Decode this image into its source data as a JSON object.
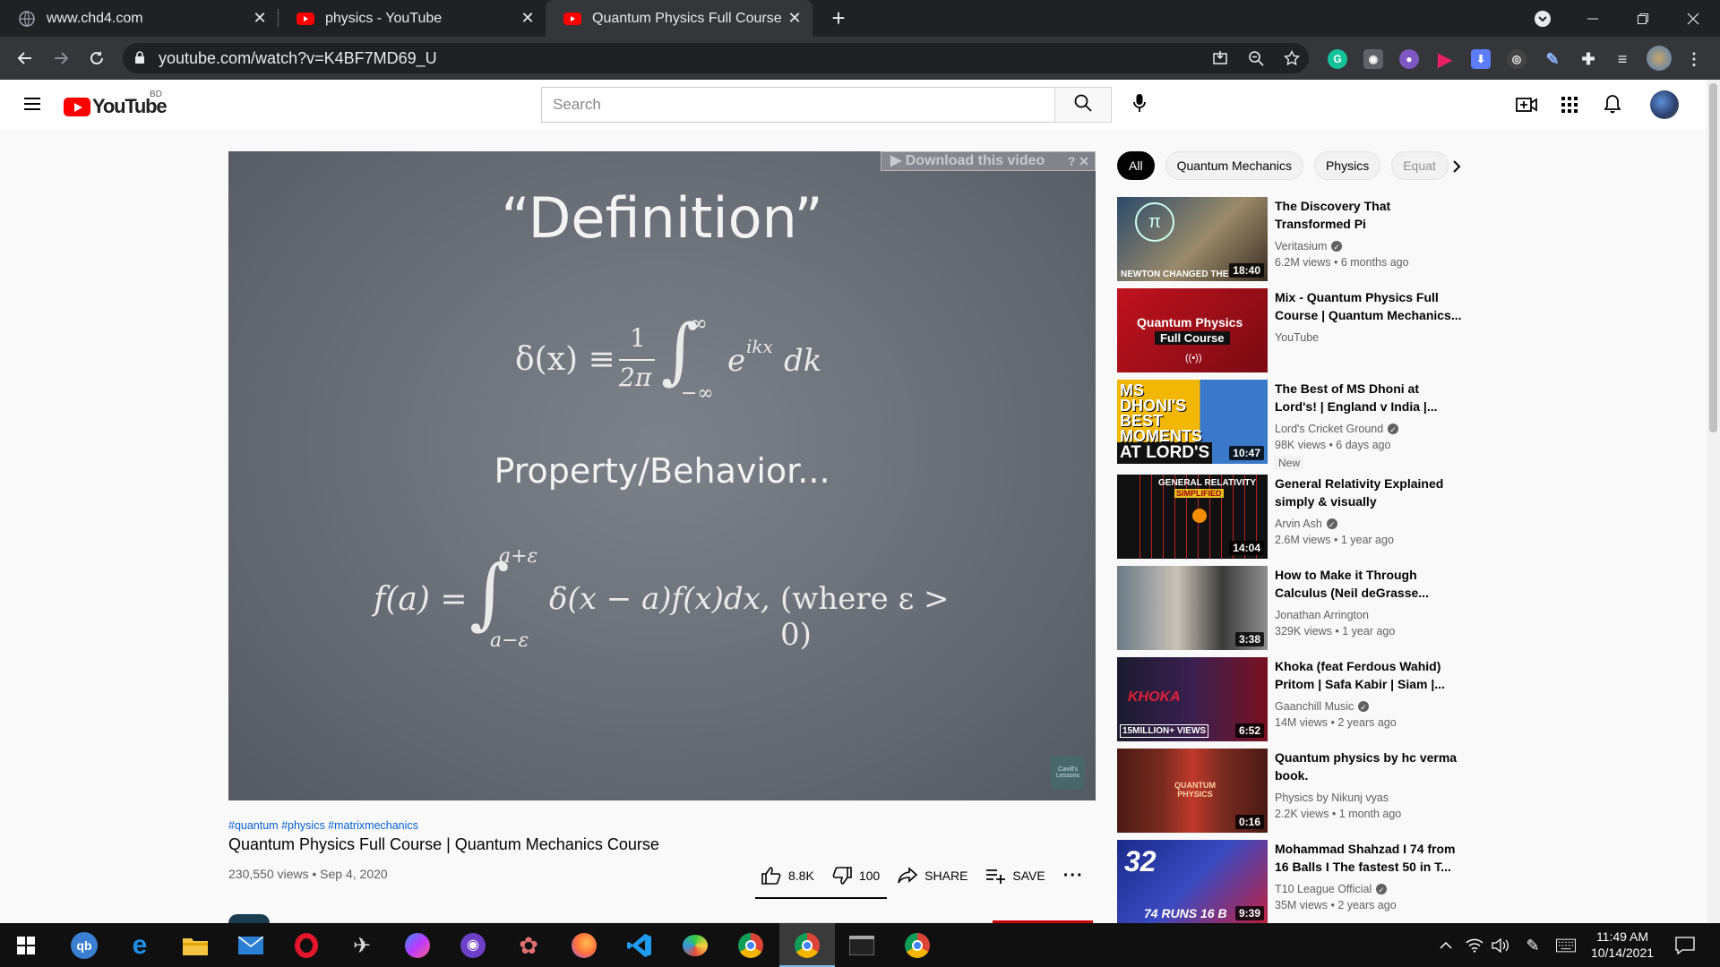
{
  "browser": {
    "tabs": [
      {
        "title": "www.chd4.com",
        "icon": "globe-icon"
      },
      {
        "title": "physics - YouTube",
        "icon": "youtube-icon"
      },
      {
        "title": "Quantum Physics Full Course | Qu",
        "icon": "youtube-icon"
      }
    ],
    "url": "youtube.com/watch?v=K4BF7MD69_U"
  },
  "youtube": {
    "logo_text": "YouTube",
    "country_code": "BD",
    "search_placeholder": "Search"
  },
  "player": {
    "download_label": "▶ Download this video",
    "download_extra": "? ✕",
    "board_title": "“Definition”",
    "board_subtitle": "Property/Behavior...",
    "formula1_lhs": "δ(x) ≡",
    "formula1_frac_num": "1",
    "formula1_frac_den": "2π",
    "formula1_integral": "∫",
    "formula1_upper": "∞",
    "formula1_lower": "−∞",
    "formula1_body": "e",
    "formula1_exp": "ikx",
    "formula1_dk": "dk",
    "formula2_lhs": "f(a) =",
    "formula2_integral": "∫",
    "formula2_upper": "a+ε",
    "formula2_lower": "a−ε",
    "formula2_body": "δ(x − a)f(x)dx,",
    "formula2_where": "(where ε > 0)",
    "watermark": "Cavill's Lessons"
  },
  "video": {
    "tags": "#quantum #physics #matrixmechanics",
    "title": "Quantum Physics Full Course | Quantum Mechanics Course",
    "meta": "230,550 views • Sep 4, 2020",
    "likes": "8.8K",
    "dislikes": "100",
    "share": "SHARE",
    "save": "SAVE",
    "like_ratio": 0.988
  },
  "chips": [
    "All",
    "Quantum Mechanics",
    "Physics",
    "Equat"
  ],
  "recommendations": [
    {
      "title": "The Discovery That Transformed Pi",
      "channel": "Veritasium",
      "verified": true,
      "views": "6.2M views • 6 months ago",
      "duration": "18:40",
      "thumb_text": "NEWTON CHANGED THE"
    },
    {
      "title": "Mix - Quantum Physics Full Course | Quantum Mechanics...",
      "channel": "YouTube",
      "verified": false,
      "views": "",
      "duration": "",
      "thumb_text": "Quantum Physics",
      "thumb_text2": "Full Course"
    },
    {
      "title": "The Best of MS Dhoni at Lord's! | England v India |...",
      "channel": "Lord's Cricket Ground",
      "verified": true,
      "views": "98K views • 6 days ago",
      "duration": "10:47",
      "badge": "New",
      "thumb_text": "MS DHONI'S BEST MOMENTS",
      "thumb_text2": "AT LORD'S"
    },
    {
      "title": "General Relativity Explained simply & visually",
      "channel": "Arvin Ash",
      "verified": true,
      "views": "2.6M views • 1 year ago",
      "duration": "14:04",
      "thumb_text": "GENERAL RELATIVITY",
      "thumb_text2": "SIMPLIFIED"
    },
    {
      "title": "How to Make it Through Calculus (Neil deGrasse...",
      "channel": "Jonathan Arrington",
      "verified": false,
      "views": "329K views • 1 year ago",
      "duration": "3:38"
    },
    {
      "title": "Khoka (feat Ferdous Wahid) Pritom | Safa Kabir | Siam |...",
      "channel": "Gaanchill Music",
      "verified": true,
      "views": "14M views • 2 years ago",
      "duration": "6:52",
      "thumb_text": "KHOKA",
      "thumb_text2": "15MILLION+ VIEWS"
    },
    {
      "title": "Quantum physics by hc verma book.",
      "channel": "Physics by Nikunj vyas",
      "verified": false,
      "views": "2.2K views • 1 month ago",
      "duration": "0:16",
      "thumb_text": "QUANTUM PHYSICS"
    },
    {
      "title": "Mohammad Shahzad I 74 from 16 Balls I The fastest 50 in T...",
      "channel": "T10 League Official",
      "verified": true,
      "views": "35M views • 2 years ago",
      "duration": "9:39",
      "thumb_text": "32",
      "thumb_text2": "74 RUNS 16 B"
    }
  ],
  "taskbar": {
    "time": "11:49 AM",
    "date": "10/14/2021"
  },
  "colors": {
    "yt_red": "#ff0000",
    "chrome_dark": "#202124",
    "chrome_toolbar": "#35363a",
    "link_blue": "#065fd4"
  }
}
